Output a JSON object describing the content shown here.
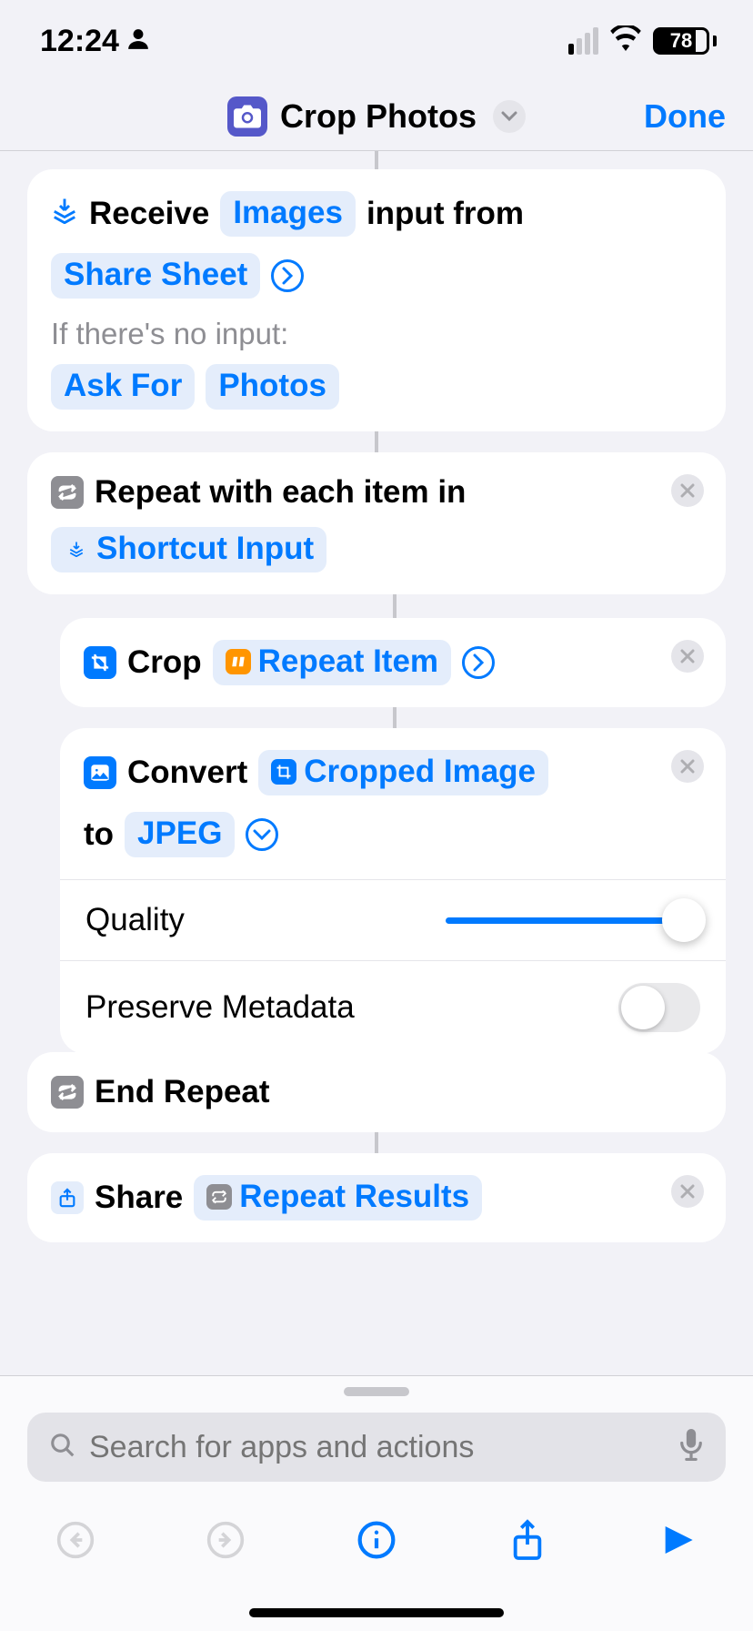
{
  "status": {
    "time": "12:24",
    "battery_pct": "78"
  },
  "nav": {
    "title": "Crop Photos",
    "done": "Done"
  },
  "receive": {
    "word_receive": "Receive",
    "images_token": "Images",
    "word_input_from": "input from",
    "share_sheet_token": "Share Sheet",
    "no_input_label": "If there's no input:",
    "ask_for_token": "Ask For",
    "photos_token": "Photos"
  },
  "repeat": {
    "title": "Repeat with each item in",
    "input_token": "Shortcut Input"
  },
  "crop": {
    "title": "Crop",
    "item_token": "Repeat Item"
  },
  "convert": {
    "title": "Convert",
    "source_token": "Cropped Image",
    "to_word": "to",
    "format_token": "JPEG",
    "quality_label": "Quality",
    "metadata_label": "Preserve Metadata"
  },
  "end_repeat": {
    "title": "End Repeat"
  },
  "share": {
    "title": "Share",
    "results_token": "Repeat Results"
  },
  "search": {
    "placeholder": "Search for apps and actions"
  }
}
